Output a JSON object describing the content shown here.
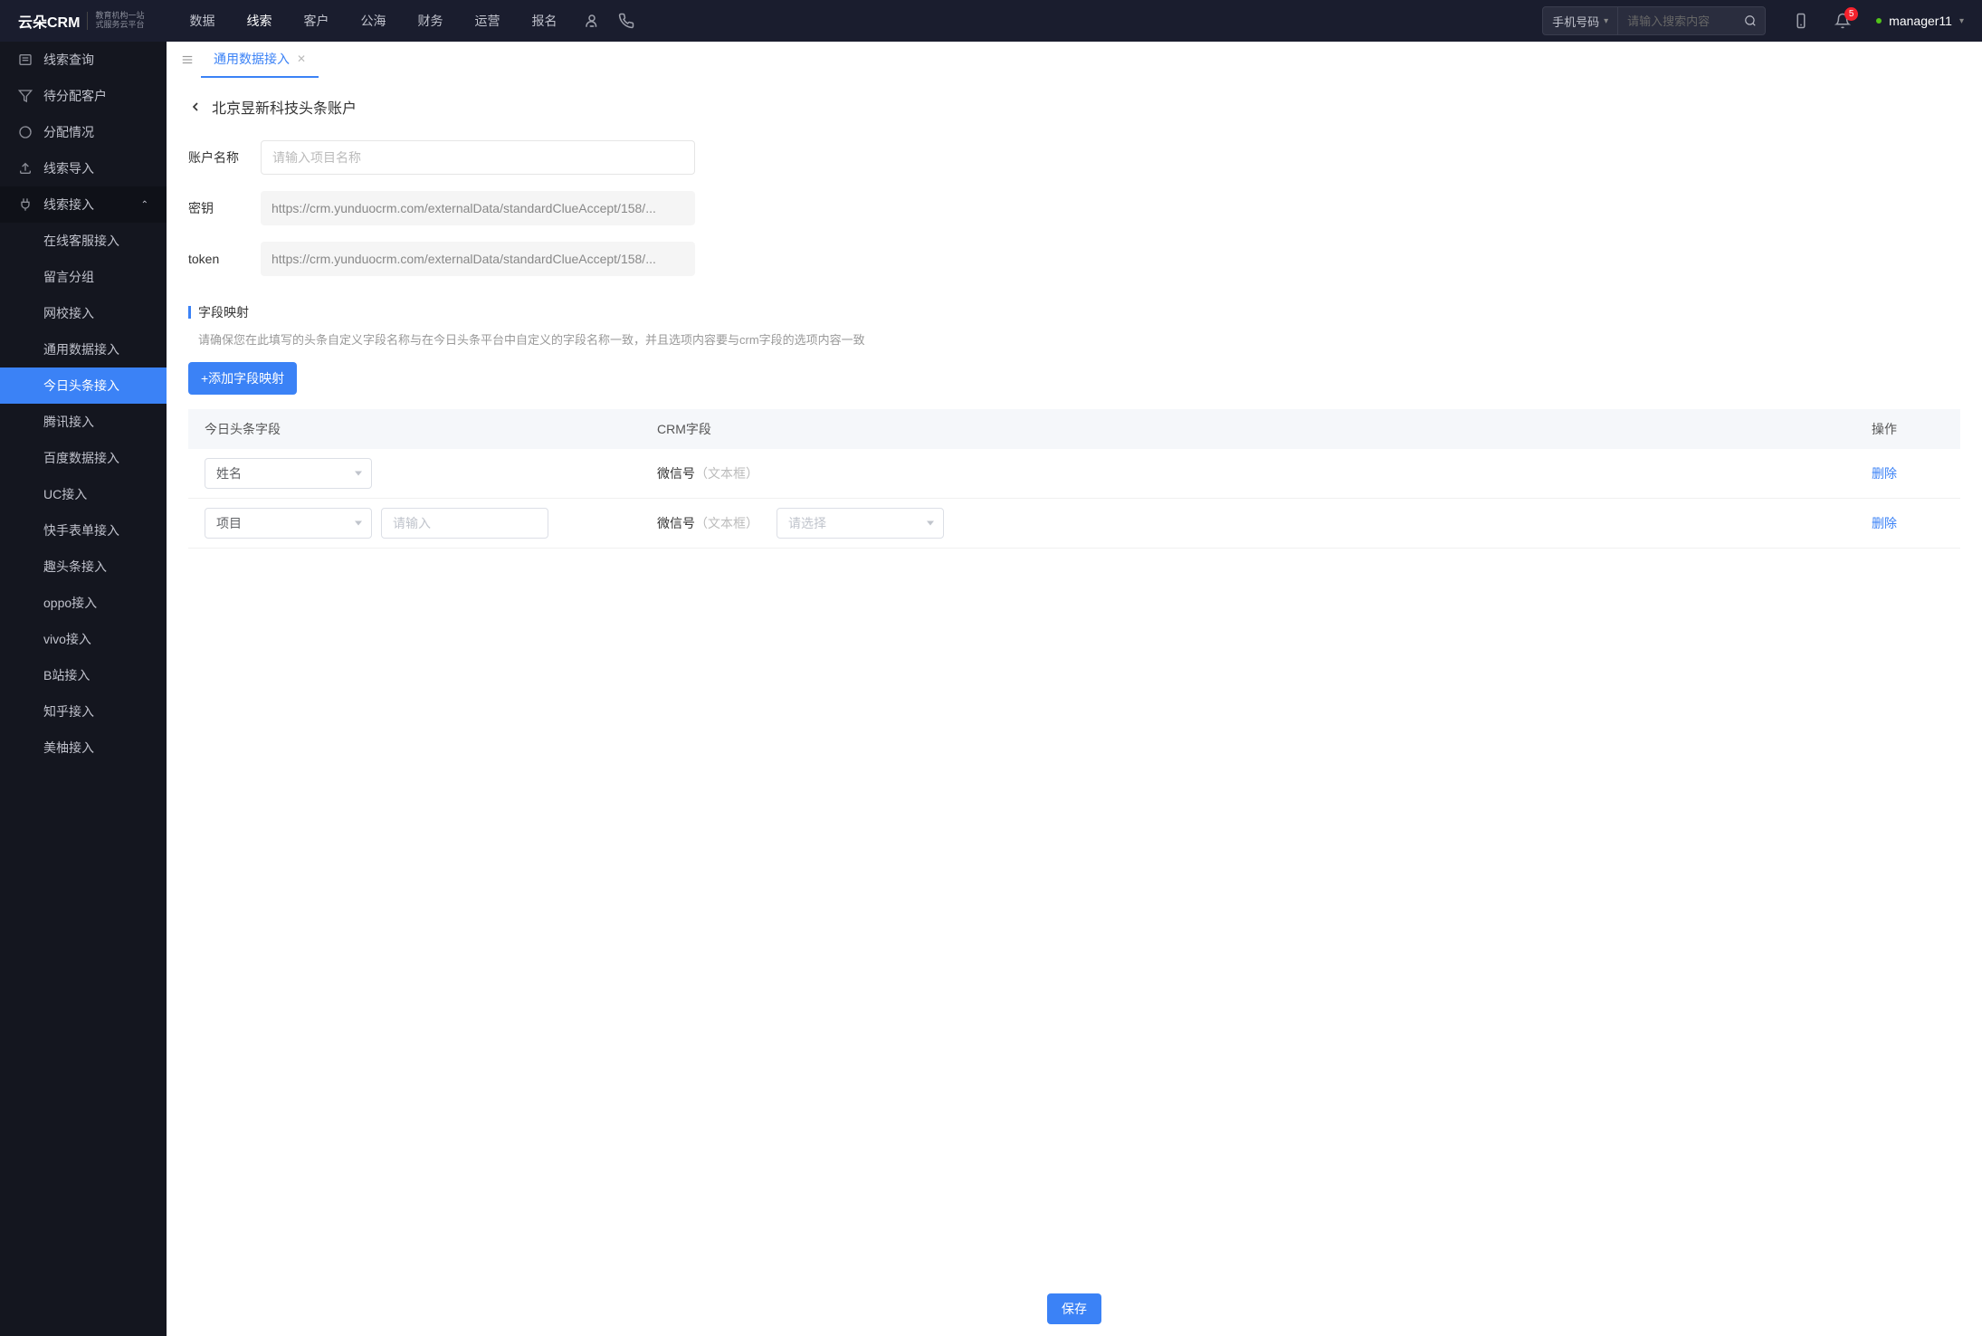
{
  "header": {
    "logo_main": "云朵CRM",
    "logo_sub1": "教育机构一站",
    "logo_sub2": "式服务云平台",
    "nav": [
      "数据",
      "线索",
      "客户",
      "公海",
      "财务",
      "运营",
      "报名"
    ],
    "nav_active_index": 1,
    "search_type": "手机号码",
    "search_placeholder": "请输入搜索内容",
    "notif_count": "5",
    "username": "manager11"
  },
  "sidebar": {
    "top": [
      {
        "label": "线索查询",
        "icon": "list"
      },
      {
        "label": "待分配客户",
        "icon": "filter"
      },
      {
        "label": "分配情况",
        "icon": "progress"
      },
      {
        "label": "线索导入",
        "icon": "upload"
      }
    ],
    "expand": {
      "label": "线索接入",
      "icon": "plug"
    },
    "subs": [
      "在线客服接入",
      "留言分组",
      "网校接入",
      "通用数据接入",
      "今日头条接入",
      "腾讯接入",
      "百度数据接入",
      "UC接入",
      "快手表单接入",
      "趣头条接入",
      "oppo接入",
      "vivo接入",
      "B站接入",
      "知乎接入",
      "美柚接入"
    ],
    "sub_active_index": 4
  },
  "tabs": {
    "active": {
      "label": "通用数据接入"
    }
  },
  "page": {
    "breadcrumb": "北京昱新科技头条账户",
    "form": {
      "name_label": "账户名称",
      "name_placeholder": "请输入项目名称",
      "key_label": "密钥",
      "key_value": "https://crm.yunduocrm.com/externalData/standardClueAccept/158/...",
      "token_label": "token",
      "token_value": "https://crm.yunduocrm.com/externalData/standardClueAccept/158/..."
    },
    "section_title": "字段映射",
    "hint": "请确保您在此填写的头条自定义字段名称与在今日头条平台中自定义的字段名称一致，并且选项内容要与crm字段的选项内容一致",
    "add_btn": "+添加字段映射",
    "table": {
      "headers": [
        "今日头条字段",
        "CRM字段",
        "操作"
      ],
      "rows": [
        {
          "tt_field": "姓名",
          "crm_field": "微信号",
          "crm_hint": "（文本框）",
          "delete": "删除",
          "extra_select": false
        },
        {
          "tt_field": "项目",
          "tt_input_placeholder": "请输入",
          "crm_field": "微信号",
          "crm_hint": "（文本框）",
          "delete": "删除",
          "extra_select": true,
          "extra_placeholder": "请选择"
        }
      ]
    },
    "save": "保存"
  }
}
